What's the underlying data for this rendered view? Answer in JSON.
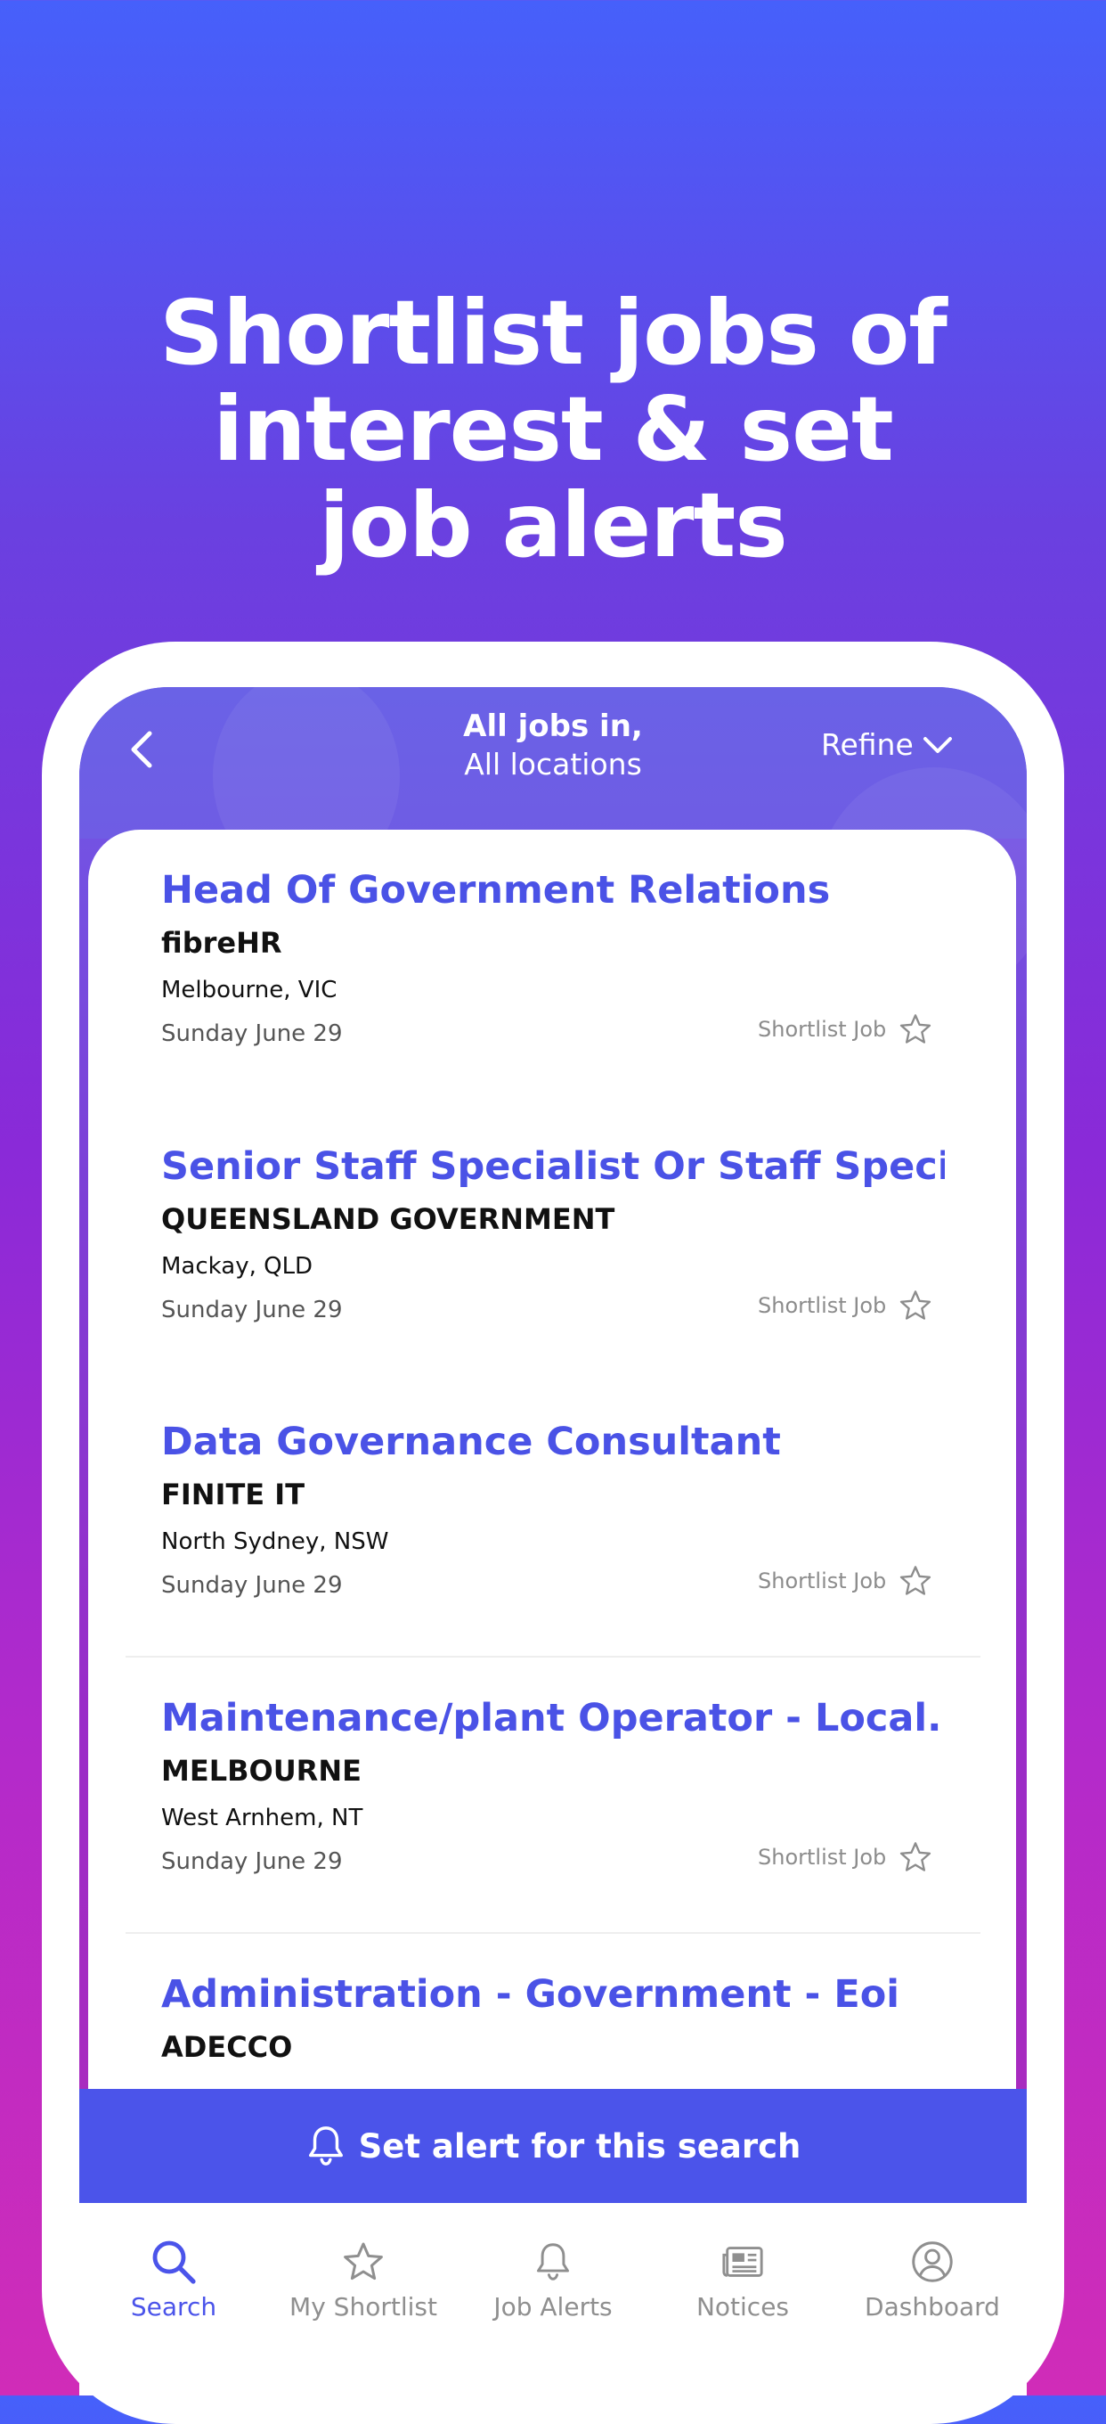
{
  "headline": {
    "line1": "Shortlist jobs of",
    "line2": "interest & set",
    "line3": "job alerts"
  },
  "header": {
    "title": "All jobs in,",
    "subtitle": "All locations",
    "refine_label": "Refine"
  },
  "jobs": [
    {
      "title": "Head Of Government Relations",
      "company": "fibreHR",
      "location": "Melbourne, VIC",
      "date": "Sunday June 29",
      "shortlist_label": "Shortlist Job"
    },
    {
      "title": "Senior Staff Specialist Or Staff Speci...",
      "company": "QUEENSLAND GOVERNMENT",
      "location": "Mackay, QLD",
      "date": "Sunday June 29",
      "shortlist_label": "Shortlist Job"
    },
    {
      "title": "Data Governance Consultant",
      "company": "FINITE IT",
      "location": "North Sydney, NSW",
      "date": "Sunday June 29",
      "shortlist_label": "Shortlist Job"
    },
    {
      "title": "Maintenance/plant Operator - Local...",
      "company": "MELBOURNE",
      "location": "West Arnhem, NT",
      "date": "Sunday June 29",
      "shortlist_label": "Shortlist Job"
    },
    {
      "title": "Administration - Government - Eoi",
      "company": "ADECCO",
      "location": "",
      "date": "",
      "shortlist_label": ""
    }
  ],
  "alert_bar": {
    "label": "Set alert for this search"
  },
  "tabs": [
    {
      "label": "Search",
      "icon": "search-icon",
      "active": true
    },
    {
      "label": "My Shortlist",
      "icon": "star-icon",
      "active": false
    },
    {
      "label": "Job Alerts",
      "icon": "bell-icon",
      "active": false
    },
    {
      "label": "Notices",
      "icon": "newspaper-icon",
      "active": false
    },
    {
      "label": "Dashboard",
      "icon": "user-circle-icon",
      "active": false
    }
  ],
  "colors": {
    "accent": "#4b54ea",
    "gradient_top": "#4660fb",
    "gradient_bottom": "#d02cb8"
  }
}
